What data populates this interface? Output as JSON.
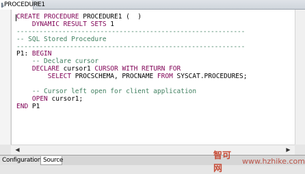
{
  "tab": {
    "title": "PROCEDURE1",
    "close": "✕"
  },
  "editor": {
    "lines": [
      [
        {
          "t": "CREATE PROCEDURE ",
          "c": "kw"
        },
        {
          "t": "PROCEDURE1 (  )",
          "c": "plain"
        }
      ],
      [
        {
          "t": "    DYNAMIC RESULT SETS ",
          "c": "kw"
        },
        {
          "t": "1",
          "c": "plain"
        }
      ],
      [
        {
          "t": "------------------------------------------------------------",
          "c": "dash"
        }
      ],
      [
        {
          "t": "-- SQL Stored Procedure",
          "c": "cm"
        }
      ],
      [
        {
          "t": "------------------------------------------------------------",
          "c": "dash"
        }
      ],
      [
        {
          "t": "P1: ",
          "c": "plain"
        },
        {
          "t": "BEGIN",
          "c": "kw"
        }
      ],
      [
        {
          "t": "    -- Declare cursor",
          "c": "cm"
        }
      ],
      [
        {
          "t": "    DECLARE ",
          "c": "kw"
        },
        {
          "t": "cursor1 ",
          "c": "plain"
        },
        {
          "t": "CURSOR WITH RETURN FOR",
          "c": "kw"
        }
      ],
      [
        {
          "t": "        SELECT ",
          "c": "kw"
        },
        {
          "t": "PROCSCHEMA, PROCNAME ",
          "c": "plain"
        },
        {
          "t": "FROM ",
          "c": "kw"
        },
        {
          "t": "SYSCAT.PROCEDURES;",
          "c": "plain"
        }
      ],
      [
        {
          "t": "",
          "c": "plain"
        }
      ],
      [
        {
          "t": "    -- Cursor left open for client application",
          "c": "cm"
        }
      ],
      [
        {
          "t": "    OPEN ",
          "c": "kw"
        },
        {
          "t": "cursor1;",
          "c": "plain"
        }
      ],
      [
        {
          "t": "END ",
          "c": "kw"
        },
        {
          "t": "P1",
          "c": "plain"
        }
      ]
    ]
  },
  "scrollbar": {
    "left_arrow": "◀",
    "right_arrow": "▶"
  },
  "bottom_tabs": {
    "configuration": "Configuration",
    "source": "Source"
  },
  "watermark": {
    "brand": "智可网",
    "url": "www.hzhike.com"
  },
  "colors": {
    "keyword": "#7f0055",
    "comment": "#3f7f5f",
    "watermark": "#c43d25"
  }
}
